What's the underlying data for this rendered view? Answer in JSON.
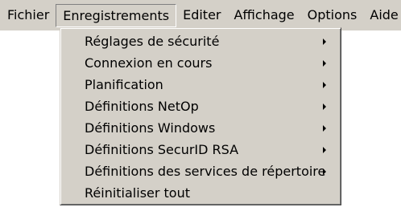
{
  "menubar": {
    "items": [
      {
        "label": "Fichier"
      },
      {
        "label": "Enregistrements"
      },
      {
        "label": "Editer"
      },
      {
        "label": "Affichage"
      },
      {
        "label": "Options"
      },
      {
        "label": "Aide"
      }
    ]
  },
  "dropdown": {
    "items": [
      {
        "label": "Réglages de sécurité",
        "submenu_icon": "chevron-right-icon"
      },
      {
        "label": "Connexion en cours",
        "submenu_icon": "chevron-right-icon"
      },
      {
        "label": "Planification",
        "submenu_icon": "chevron-right-icon"
      },
      {
        "label": "Définitions NetOp",
        "submenu_icon": "chevron-right-icon"
      },
      {
        "label": "Définitions Windows",
        "submenu_icon": "chevron-right-icon"
      },
      {
        "label": "Définitions SecurID RSA",
        "submenu_icon": "chevron-right-icon"
      },
      {
        "label": "Définitions des services de répertoire",
        "submenu_icon": "chevron-right-icon"
      },
      {
        "label": "Réinitialiser tout"
      }
    ]
  },
  "colors": {
    "menu_background": "#d4d0c8",
    "text": "#000000",
    "highlight_light": "#ffffff",
    "shadow": "#808080"
  }
}
